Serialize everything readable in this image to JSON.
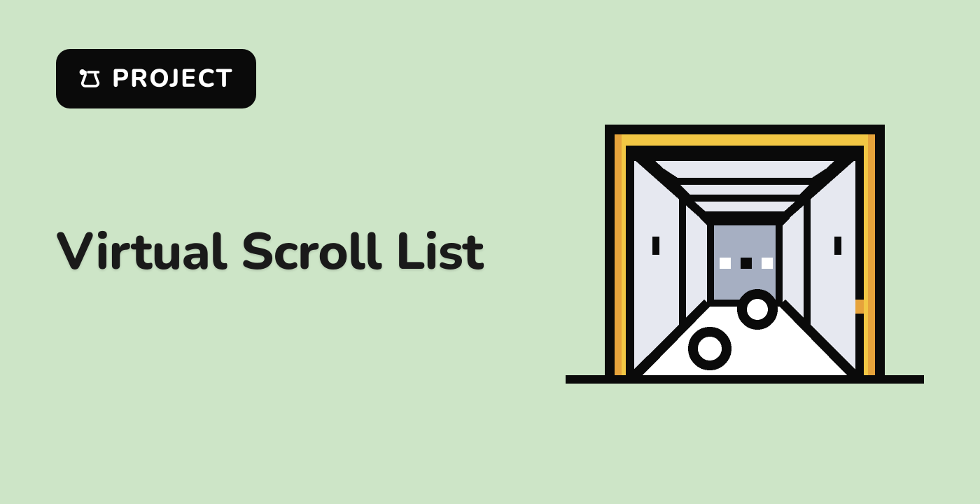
{
  "badge": {
    "label": "PROJECT",
    "icon": "lab-flask-icon"
  },
  "title": "Virtual Scroll List",
  "illustration": {
    "name": "elevator-illustration"
  },
  "colors": {
    "background": "#cde5c7",
    "badge_bg": "#0a0a0a",
    "badge_fg": "#ffffff",
    "text": "#1a1a1a",
    "illus_yellow": "#f2c744",
    "illus_orange": "#e6a33b",
    "illus_light": "#e6e8f0",
    "illus_grey": "#a6afc2",
    "illus_white": "#ffffff",
    "illus_black": "#0a0a0a"
  }
}
